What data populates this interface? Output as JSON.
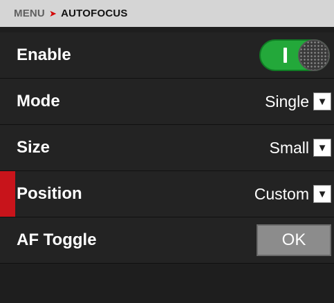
{
  "breadcrumb": {
    "menu": "MENU",
    "separator": "➤",
    "current": "AUTOFOCUS"
  },
  "settings": {
    "enable": {
      "label": "Enable",
      "state": "on",
      "toggle_color": "#23a83a"
    },
    "mode": {
      "label": "Mode",
      "value": "Single"
    },
    "size": {
      "label": "Size",
      "value": "Small"
    },
    "position": {
      "label": "Position",
      "value": "Custom",
      "selected": true,
      "selection_color": "#c8141b"
    },
    "af_toggle": {
      "label": "AF Toggle",
      "button": "OK"
    }
  },
  "icons": {
    "dropdown": "chevron-down-icon",
    "breadcrumb_separator": "arrow-right-icon"
  }
}
